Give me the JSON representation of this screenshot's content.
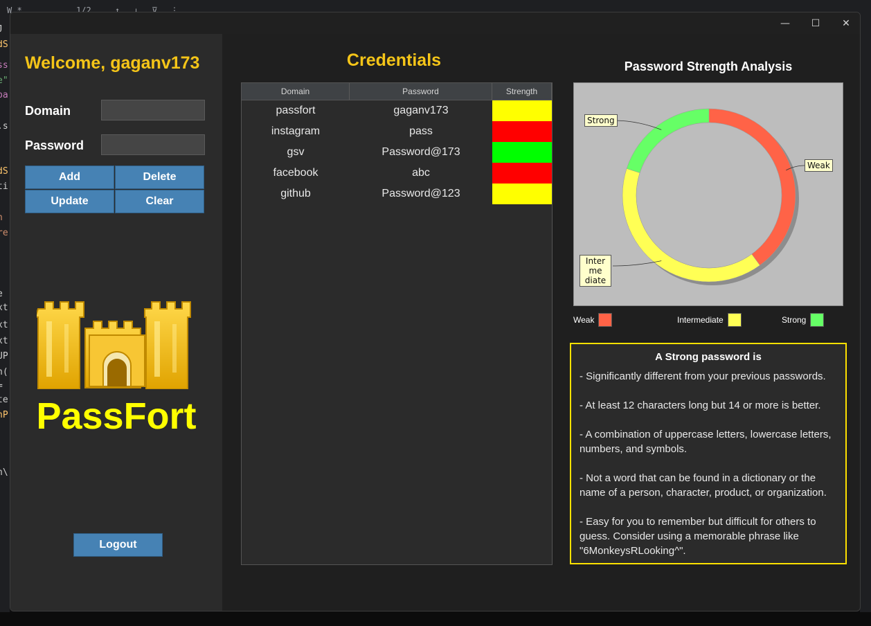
{
  "background": {
    "tab_label": "W  *",
    "match_count": "1/2",
    "gutter_snippets": [
      "J",
      "dS",
      "ss",
      "e\"",
      "pa",
      ".s",
      "dS",
      "ti",
      "n",
      "re",
      "e",
      "xt",
      "xt",
      "xt",
      "UP",
      "n(",
      " =",
      "te",
      "nP",
      "n\\"
    ]
  },
  "window": {
    "controls": {
      "minimize": "—",
      "maximize": "☐",
      "close": "✕"
    }
  },
  "sidebar": {
    "welcome": "Welcome, gaganv173",
    "domain_label": "Domain",
    "domain_value": "",
    "password_label": "Password",
    "password_value": "",
    "buttons": {
      "add": "Add",
      "delete": "Delete",
      "update": "Update",
      "clear": "Clear"
    },
    "brand": "PassFort",
    "logout": "Logout"
  },
  "credentials": {
    "title": "Credentials",
    "columns": [
      "Domain",
      "Password",
      "Strength"
    ],
    "rows": [
      {
        "domain": "passfort",
        "password": "gaganv173",
        "strength": "Intermediate",
        "color": "#ffff00"
      },
      {
        "domain": "instagram",
        "password": "pass",
        "strength": "Weak",
        "color": "#ff0000"
      },
      {
        "domain": "gsv",
        "password": "Password@173",
        "strength": "Strong",
        "color": "#00ff00"
      },
      {
        "domain": "facebook",
        "password": "abc",
        "strength": "Weak",
        "color": "#ff0000"
      },
      {
        "domain": "github",
        "password": "Password@123",
        "strength": "Intermediate",
        "color": "#ffff00"
      }
    ]
  },
  "chart_data": {
    "type": "pie",
    "style": "donut",
    "title": "Password Strength Analysis",
    "categories": [
      "Weak",
      "Intermediate",
      "Strong"
    ],
    "values": [
      2,
      2,
      1
    ],
    "colors": [
      "#ff6347",
      "#ffff55",
      "#66ff66"
    ],
    "legend_position": "bottom"
  },
  "info": {
    "title": "A Strong password is",
    "items": [
      "- Significantly different from your previous passwords.",
      "- At least 12 characters long but 14 or more is better.",
      "- A combination of uppercase letters, lowercase letters,\n  numbers, and symbols.",
      "- Not a word that can be found in a dictionary or the\n  name of a person, character, product, or organization.",
      "- Easy for you to remember but difficult for others to\n  guess. Consider using a memorable phrase like\n  \"6MonkeysRLooking^\"."
    ]
  }
}
